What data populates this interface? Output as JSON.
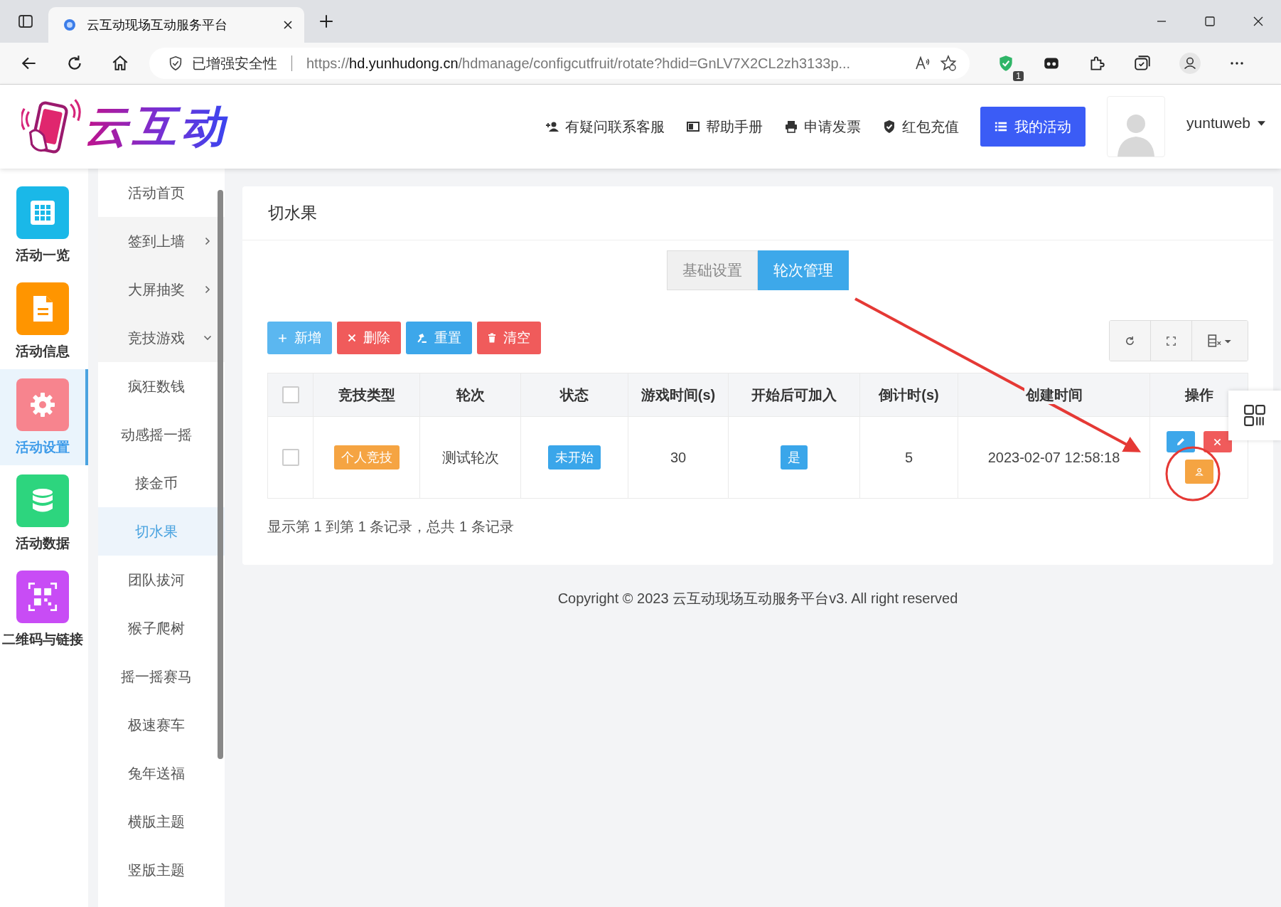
{
  "browser": {
    "tab_title": "云互动现场互动服务平台",
    "security_label": "已增强安全性",
    "url": {
      "scheme": "https://",
      "host": "hd.yunhudong.cn",
      "path": "/hdmanage/configcutfruit/rotate?hdid=GnLV7X2CL2zh3133p..."
    },
    "extension_badge": "1"
  },
  "header": {
    "logo_text": "云互动",
    "nav": [
      {
        "label": "有疑问联系客服",
        "kind": "support"
      },
      {
        "label": "帮助手册",
        "kind": "manual"
      },
      {
        "label": "申请发票",
        "kind": "invoice"
      },
      {
        "label": "红包充值",
        "kind": "recharge"
      }
    ],
    "primary_button": "我的活动",
    "username": "yuntuweb"
  },
  "sidebar": {
    "items": [
      {
        "label": "活动一览",
        "kind": "grid",
        "color": "#1ab8e8",
        "selected": false
      },
      {
        "label": "活动信息",
        "kind": "document",
        "color": "#ff9500",
        "selected": false
      },
      {
        "label": "活动设置",
        "kind": "settings",
        "color": "#f7848e",
        "selected": true
      },
      {
        "label": "活动数据",
        "kind": "database",
        "color": "#2dd57e",
        "selected": false
      },
      {
        "label": "二维码与链接",
        "kind": "qr",
        "color": "#c84cf5",
        "selected": false
      }
    ]
  },
  "submenu": {
    "items": [
      {
        "label": "活动首页",
        "kind": "link",
        "selected": false
      },
      {
        "label": "签到上墙",
        "kind": "group",
        "expanded": false
      },
      {
        "label": "大屏抽奖",
        "kind": "group",
        "expanded": false
      },
      {
        "label": "竞技游戏",
        "kind": "group",
        "expanded": true,
        "children": [
          {
            "label": "疯狂数钱",
            "selected": false
          },
          {
            "label": "动感摇一摇",
            "selected": false
          },
          {
            "label": "接金币",
            "selected": false
          },
          {
            "label": "切水果",
            "selected": true
          },
          {
            "label": "团队拔河",
            "selected": false
          },
          {
            "label": "猴子爬树",
            "selected": false
          },
          {
            "label": "摇一摇赛马",
            "selected": false
          },
          {
            "label": "极速赛车",
            "selected": false
          },
          {
            "label": "兔年送福",
            "selected": false
          },
          {
            "label": "横版主题",
            "selected": false
          },
          {
            "label": "竖版主题",
            "selected": false
          }
        ]
      }
    ]
  },
  "page": {
    "title": "切水果",
    "tabs": [
      {
        "label": "基础设置",
        "selected": false
      },
      {
        "label": "轮次管理",
        "selected": true
      }
    ],
    "toolbar": [
      {
        "label": "新增",
        "kind": "add"
      },
      {
        "label": "删除",
        "kind": "delete"
      },
      {
        "label": "重置",
        "kind": "reset"
      },
      {
        "label": "清空",
        "kind": "clear"
      }
    ],
    "table": {
      "select_all": {
        "checked": false
      },
      "columns": [
        "竞技类型",
        "轮次",
        "状态",
        "游戏时间(s)",
        "开始后可加入",
        "倒计时(s)",
        "创建时间",
        "操作"
      ],
      "rows": [
        {
          "checked": false,
          "type": "个人竞技",
          "round": "测试轮次",
          "status": "未开始",
          "duration": "30",
          "join_after_start": "是",
          "countdown": "5",
          "created": "2023-02-07 12:58:18"
        }
      ]
    },
    "summary": "显示第 1 到第 1 条记录，总共 1 条记录"
  },
  "copyright": "Copyright © 2023 云互动现场互动服务平台v3. All right reserved"
}
